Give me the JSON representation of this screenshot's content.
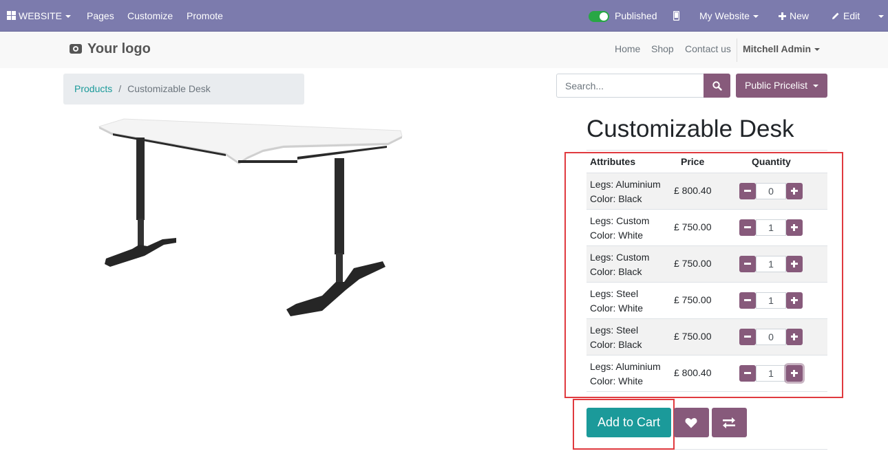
{
  "adminbar": {
    "app_label": "WEBSITE",
    "menu": [
      "Pages",
      "Customize",
      "Promote"
    ],
    "published_label": "Published",
    "website_label": "My Website",
    "new_label": "New",
    "edit_label": "Edit",
    "icons": {
      "apps": "grid-icon",
      "mobile": "mobile-icon",
      "new": "plus-icon",
      "edit": "pencil-icon"
    }
  },
  "header": {
    "logo_text": "Your logo",
    "nav": [
      "Home",
      "Shop",
      "Contact us"
    ],
    "user": "Mitchell Admin"
  },
  "breadcrumb": {
    "parent": "Products",
    "separator": "/",
    "current": "Customizable Desk"
  },
  "search": {
    "placeholder": "Search...",
    "pricelist_label": "Public Pricelist"
  },
  "product": {
    "title": "Customizable Desk"
  },
  "table": {
    "headers": {
      "attributes": "Attributes",
      "price": "Price",
      "quantity": "Quantity"
    },
    "rows": [
      {
        "legs": "Legs: Aluminium",
        "color": "Color: Black",
        "price": "£ 800.40",
        "qty": "0"
      },
      {
        "legs": "Legs: Custom",
        "color": "Color: White",
        "price": "£ 750.00",
        "qty": "1"
      },
      {
        "legs": "Legs: Custom",
        "color": "Color: Black",
        "price": "£ 750.00",
        "qty": "1"
      },
      {
        "legs": "Legs: Steel",
        "color": "Color: White",
        "price": "£ 750.00",
        "qty": "1"
      },
      {
        "legs": "Legs: Steel",
        "color": "Color: Black",
        "price": "£ 750.00",
        "qty": "0"
      },
      {
        "legs": "Legs: Aluminium",
        "color": "Color: White",
        "price": "£ 800.40",
        "qty": "1"
      }
    ]
  },
  "actions": {
    "add_to_cart": "Add to Cart",
    "wishlist_icon": "heart-icon",
    "compare_icon": "exchange-icon"
  },
  "colors": {
    "adminbar": "#7c7bad",
    "primary": "#875a7b",
    "cart": "#1b9a9a",
    "highlight": "#e0393e"
  }
}
